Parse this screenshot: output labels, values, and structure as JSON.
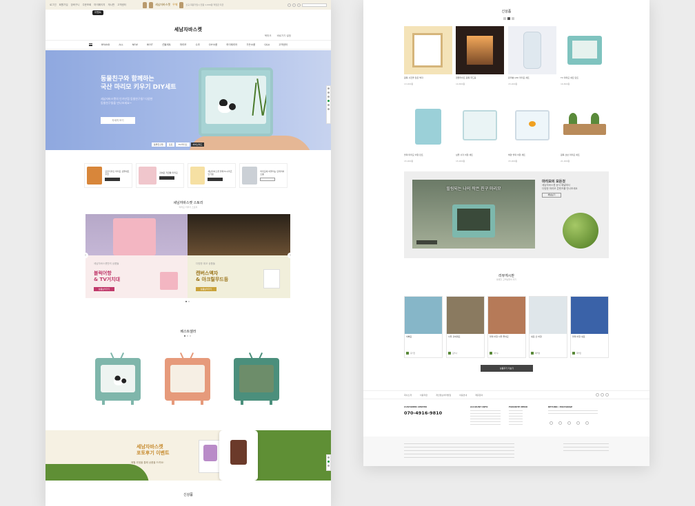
{
  "left": {
    "topbar": {
      "links": [
        "로그인",
        "회원가입",
        "장바구니",
        "주문조회",
        "마이페이지",
        "게시판",
        "고객센터"
      ],
      "promo_brand": "세남자바스켓",
      "promo_word": "우체",
      "promo_tail": "신규 회원가입시 전원 1,000원 적립금 지급",
      "badge": "이벤트"
    },
    "brand": "세남자바스켓",
    "brand_links": [
      "북마크",
      "바로가기 설정"
    ],
    "nav": [
      "BRAND",
      "ALL",
      "NEW",
      "BEST",
      "선물세트",
      "마리모",
      "수초",
      "DIY소품",
      "하이테리어",
      "가든소품",
      "Q&A",
      "고객센터"
    ],
    "hero": {
      "title_line1": "동물친구와 함께하는",
      "title_line2": "국산 마리모 키우기 DIY세트",
      "desc": "세남자바스켓의 인기만점 동물친구들! 다양한 동물친구들을 만나보세요~",
      "button": "자세히 보기",
      "tabs": [
        "동물친구들",
        "포토",
        "TV/라디오",
        "하비브레드"
      ]
    },
    "cats": [
      {
        "text": "모던디자인 마리모 선물세트 추천",
        "color": "#d8863a"
      },
      {
        "text": "귀여운 저금통 마리모",
        "color": "#f0c6cc"
      },
      {
        "text": "세남자바스켓 블럭TV시리즈 인기템",
        "color": "#f6e0a3"
      },
      {
        "text": "마리모에 어울리는 인테리어 소품",
        "color": "#cbd0d6"
      }
    ],
    "story": {
      "title": "세남자바스켓 스토리",
      "sub": "마리모 키우기 스토리",
      "left_label": "세남자바스켓만의 상품들",
      "left_title_1": "블럭어항",
      "left_title_2": "& TV거치대",
      "left_btn": "상품보러가기",
      "right_label": "다양한 데코 상품들",
      "right_title_1": "캔버스액자",
      "right_title_2": "& 아크릴무드등",
      "right_btn": "상품보러가기"
    },
    "best_title": "베스트셀러",
    "best": [
      {
        "frame": "#7fb6ab",
        "screen": "#eef4f1"
      },
      {
        "frame": "#e69a7b",
        "screen": "#f6efe4"
      },
      {
        "frame": "#4b8f7c",
        "screen": "#6d8d6a"
      }
    ],
    "event": {
      "title_line1": "세남자바스켓",
      "title_line2": "포토후기 이벤트",
      "desc": "매월 추첨을 통해 상품을 드려요!"
    },
    "bottom_title": "신상품"
  },
  "right": {
    "title": "신상품",
    "products": [
      {
        "name": "원목 사진을 담은 액자",
        "price": "13,900원",
        "color": "#f4e3b8"
      },
      {
        "name": "캔들라이트 원목 무드등",
        "price": "19,800원",
        "color": "#2a1d18"
      },
      {
        "name": "유리병 LED 마리모 세트",
        "price": "15,900원",
        "color": "#eef0f5"
      },
      {
        "name": "TV 마리모 세트 민트",
        "price": "16,800원",
        "color": "#dfeff0"
      },
      {
        "name": "블럭 마리모 어항 민트",
        "price": "15,900원",
        "color": "#f4f4f4"
      },
      {
        "name": "심플 사각 어항 세트",
        "price": "15,900원",
        "color": "#f4f4f4"
      },
      {
        "name": "해양 블럭 어항 세트",
        "price": "15,900원",
        "color": "#f4f4f4"
      },
      {
        "name": "원목 선반 마리모 세트",
        "price": "21,900원",
        "color": "#f4f4f4"
      }
    ],
    "video": {
      "caption": "힐링되는 나의 작은 친구 마리모",
      "desc_line1": "마리모의 모든것",
      "desc_line2": "세남자바스켓 공식 채널에서",
      "desc_line3": "다양한 마리모 콘텐츠를 만나보세요",
      "btn": "채널보기"
    },
    "reviews_title": "리뷰게시판",
    "reviews_sub": "생생한 고객님들의 후기",
    "reviews": [
      {
        "title": "이뻐요",
        "user": "홍*진",
        "color": "#86b6c8"
      },
      {
        "title": "너무 귀여워요",
        "user": "김*나",
        "color": "#8a7a60"
      },
      {
        "title": "블럭 어항 너무 좋아요",
        "user": "이*수",
        "color": "#b67a58"
      },
      {
        "title": "새로 산 어항",
        "user": "박*영",
        "color": "#dfe6ea"
      },
      {
        "title": "블럭 어항 새로",
        "user": "최*민",
        "color": "#3a62a8"
      }
    ],
    "more_btn": "상품후기 더보기",
    "footer": {
      "links": [
        "회사소개",
        "이용약관",
        "개인정보처리방침",
        "이용안내",
        "제휴문의"
      ],
      "cs_label": "CUSTOMER CENTER",
      "phone": "070-4916-9810",
      "account_label": "ACCOUNT INFO",
      "fav_label": "FAVORITE MENU",
      "return_label": "RETURN / EXCHANGE"
    }
  }
}
